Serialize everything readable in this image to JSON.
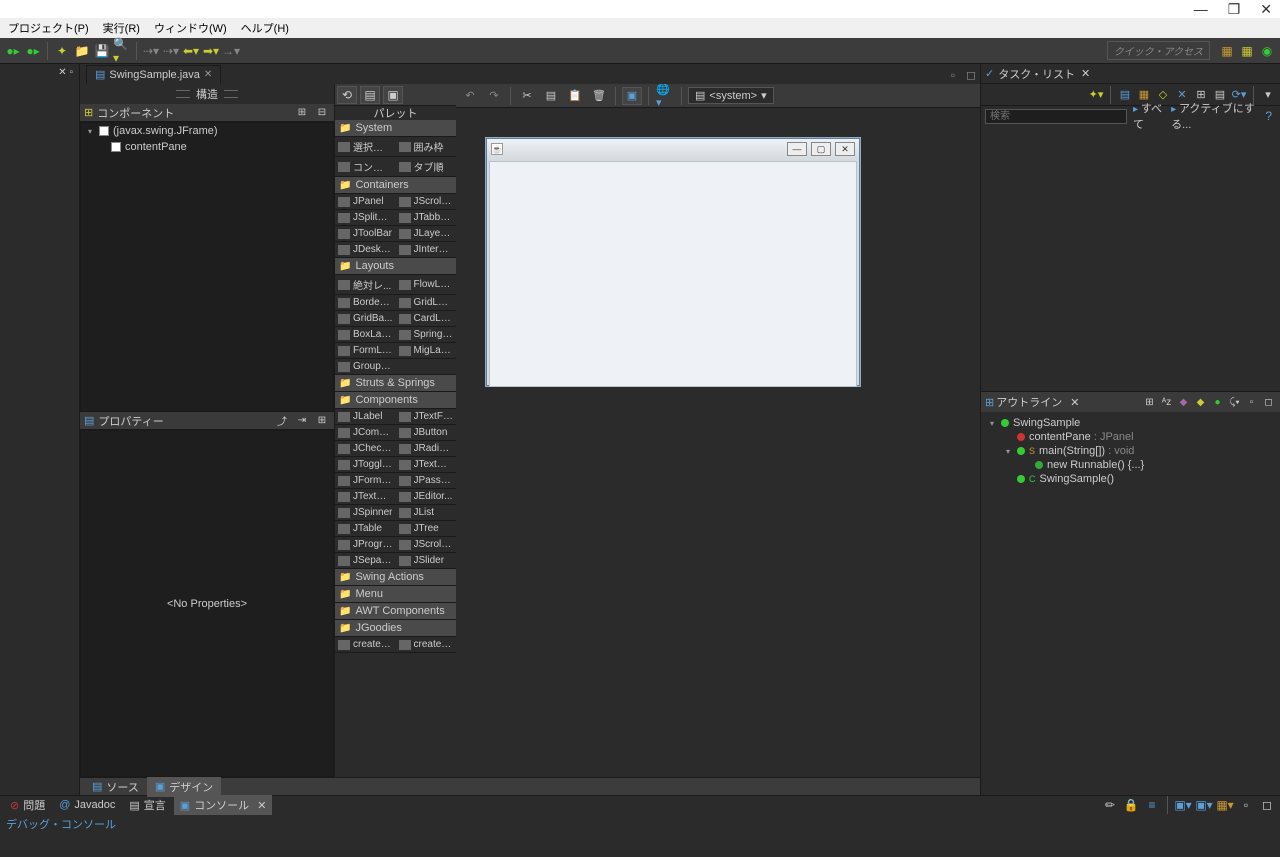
{
  "titlebar": {
    "minimize": "—",
    "restore": "❐",
    "close": "✕"
  },
  "menubar": {
    "project": "プロジェクト(P)",
    "run": "実行(R)",
    "window": "ウィンドウ(W)",
    "help": "ヘルプ(H)"
  },
  "toolbar": {
    "quick_access": "クイック・アクセス"
  },
  "editor": {
    "tab_title": "SwingSample.java",
    "struct_label": "構造",
    "palette_label": "パレット"
  },
  "components": {
    "header": "コンポーネント",
    "root": "(javax.swing.JFrame)",
    "child": "contentPane"
  },
  "properties": {
    "header": "プロパティー",
    "empty": "<No Properties>"
  },
  "palette": {
    "system": {
      "label": "System",
      "items": [
        [
          "選択範囲",
          "囲み枠"
        ],
        [
          "コンポー...",
          "タブ順"
        ]
      ]
    },
    "containers": {
      "label": "Containers",
      "items": [
        [
          "JPanel",
          "JScrollP..."
        ],
        [
          "JSplitPa...",
          "JTabbe..."
        ],
        [
          "JToolBar",
          "JLayere..."
        ],
        [
          "JDeskto...",
          "JInterna..."
        ]
      ]
    },
    "layouts": {
      "label": "Layouts",
      "items": [
        [
          "絶対レ...",
          "FlowLa..."
        ],
        [
          "BorderL...",
          "GridLay..."
        ],
        [
          "GridBa...",
          "CardLa..."
        ],
        [
          "BoxLay...",
          "SpringL..."
        ],
        [
          "FormLa...",
          "MigLay..."
        ],
        [
          "GroupL...",
          ""
        ]
      ]
    },
    "struts": {
      "label": "Struts & Springs"
    },
    "components_cat": {
      "label": "Components",
      "items": [
        [
          "JLabel",
          "JTextFie..."
        ],
        [
          "JComb...",
          "JButton"
        ],
        [
          "JCheck...",
          "JRadioB..."
        ],
        [
          "JToggle...",
          "JTextArea"
        ],
        [
          "JFormat...",
          "JPassw..."
        ],
        [
          "JTextPa...",
          "JEditor..."
        ],
        [
          "JSpinner",
          "JList"
        ],
        [
          "JTable",
          "JTree"
        ],
        [
          "JProgre...",
          "JScrollBar"
        ],
        [
          "JSepara...",
          "JSlider"
        ]
      ]
    },
    "swing_actions": {
      "label": "Swing Actions"
    },
    "menu": {
      "label": "Menu"
    },
    "awt": {
      "label": "AWT Components"
    },
    "jgoodies": {
      "label": "JGoodies",
      "items": [
        [
          "createL...",
          "createTi..."
        ]
      ]
    }
  },
  "design_toolbar": {
    "system_drop": "<system>"
  },
  "design_footer": "",
  "bottom_tabs": {
    "source": "ソース",
    "design": "デザイン"
  },
  "tasklist": {
    "header": "タスク・リスト",
    "search_placeholder": "検索",
    "all": "すべて",
    "activate": "アクティブにする..."
  },
  "outline": {
    "header": "アウトライン",
    "items": {
      "root": "SwingSample",
      "contentPane": "contentPane",
      "contentPane_type": " : JPanel",
      "main": "main(String[])",
      "main_ret": " : void",
      "runnable": "new Runnable() {...}",
      "ctor": "SwingSample()"
    }
  },
  "console": {
    "tabs": {
      "problems": "問題",
      "javadoc": "Javadoc",
      "decl": "宣言",
      "console": "コンソール"
    },
    "body": "デバッグ・コンソール"
  }
}
